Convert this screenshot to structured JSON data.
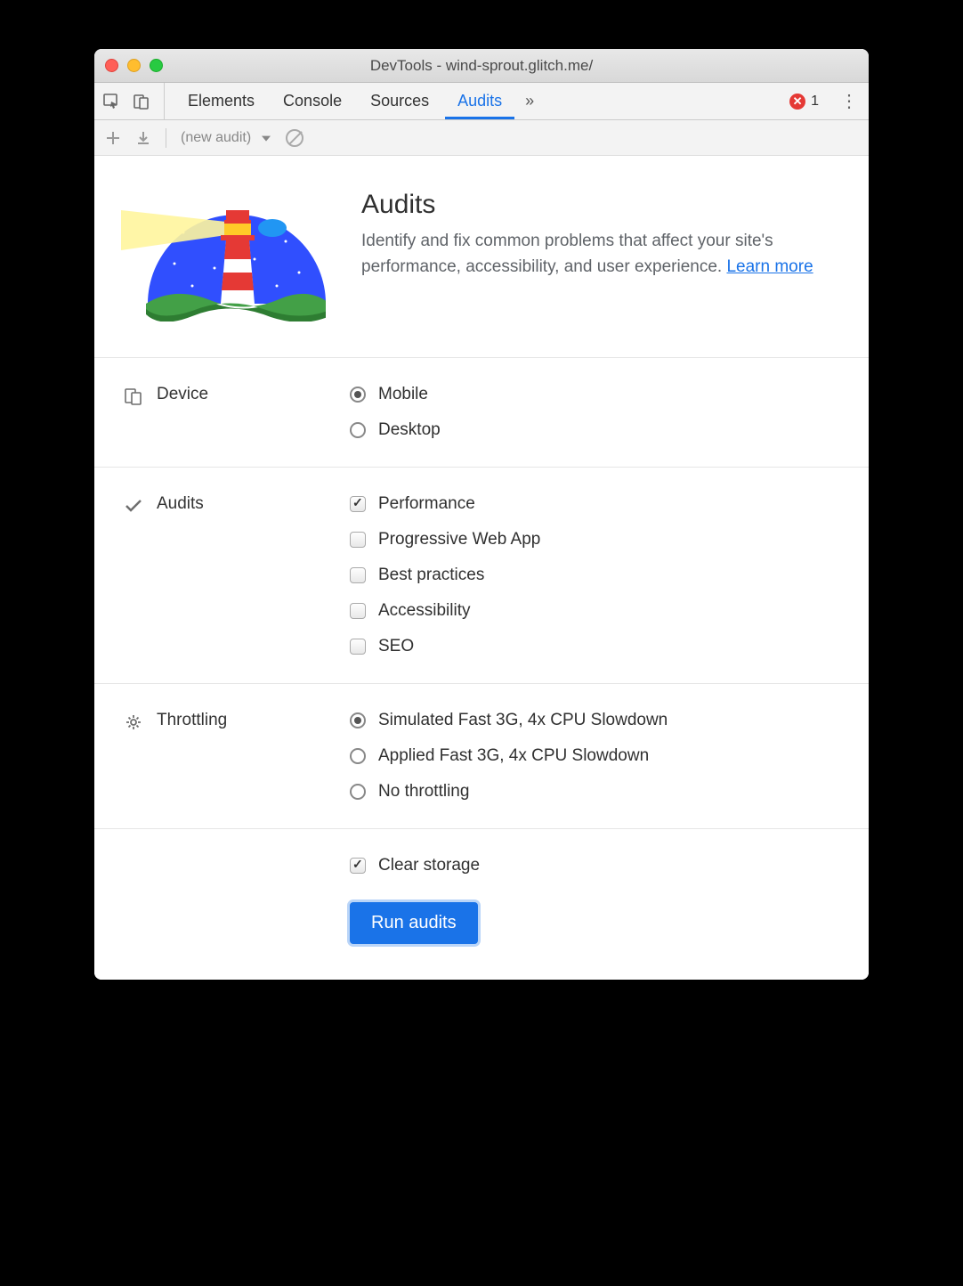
{
  "window": {
    "title": "DevTools - wind-sprout.glitch.me/"
  },
  "tabs": {
    "elements": "Elements",
    "console": "Console",
    "sources": "Sources",
    "audits": "Audits",
    "more": "»",
    "active": "audits"
  },
  "errors": {
    "count": "1"
  },
  "toolbar": {
    "audit_select": "(new audit)"
  },
  "hero": {
    "title": "Audits",
    "description": "Identify and fix common problems that affect your site's performance, accessibility, and user experience.",
    "learn_more": "Learn more"
  },
  "sections": {
    "device": {
      "label": "Device",
      "options": [
        {
          "label": "Mobile",
          "checked": true
        },
        {
          "label": "Desktop",
          "checked": false
        }
      ]
    },
    "audits": {
      "label": "Audits",
      "options": [
        {
          "label": "Performance",
          "checked": true
        },
        {
          "label": "Progressive Web App",
          "checked": false
        },
        {
          "label": "Best practices",
          "checked": false
        },
        {
          "label": "Accessibility",
          "checked": false
        },
        {
          "label": "SEO",
          "checked": false
        }
      ]
    },
    "throttling": {
      "label": "Throttling",
      "options": [
        {
          "label": "Simulated Fast 3G, 4x CPU Slowdown",
          "checked": true
        },
        {
          "label": "Applied Fast 3G, 4x CPU Slowdown",
          "checked": false
        },
        {
          "label": "No throttling",
          "checked": false
        }
      ]
    },
    "clear_storage": {
      "label": "Clear storage",
      "checked": true
    }
  },
  "run_button": "Run audits"
}
